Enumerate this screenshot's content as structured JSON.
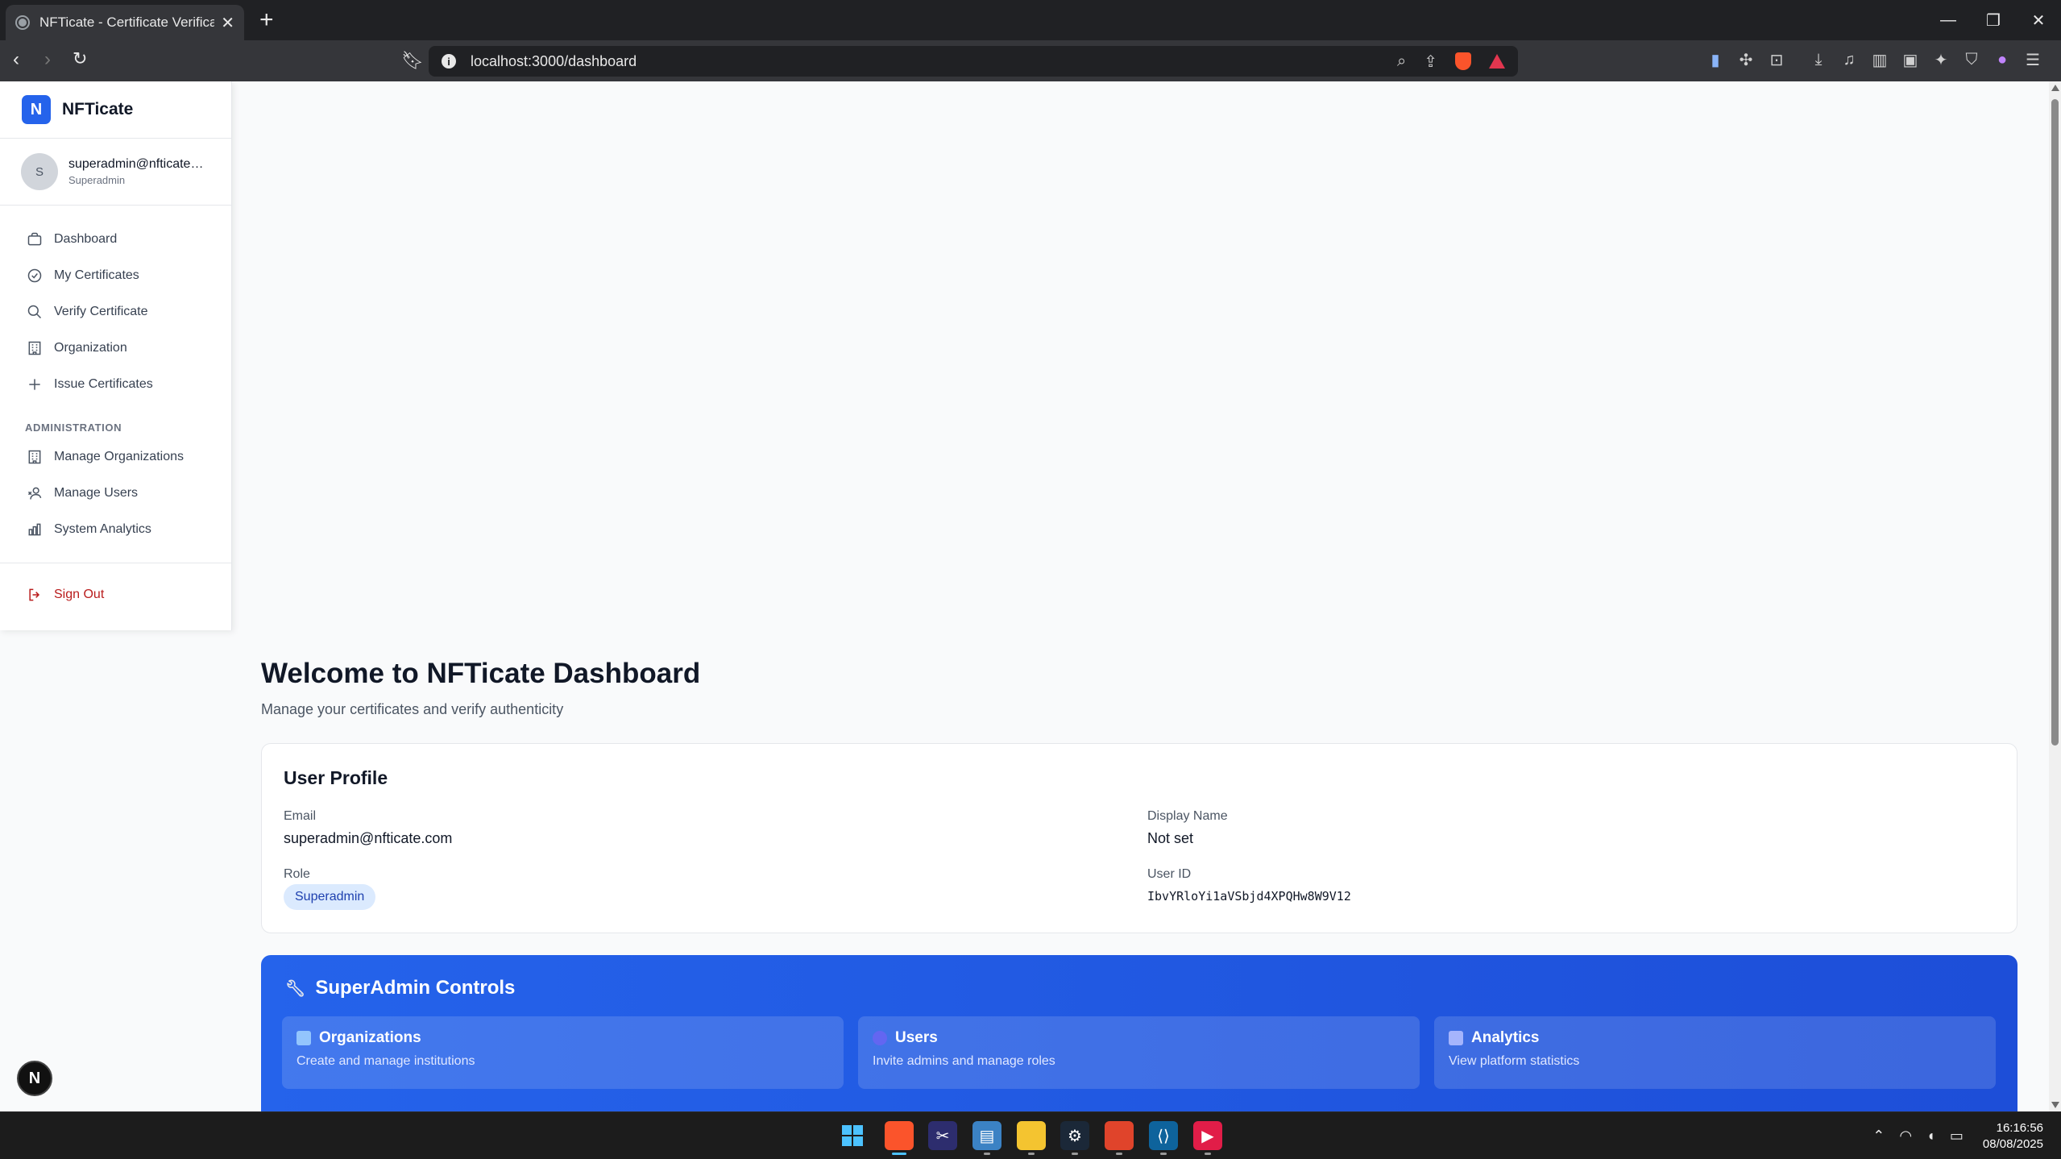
{
  "browser": {
    "tab_title": "NFTicate - Certificate Verification",
    "url": "localhost:3000/dashboard"
  },
  "sidebar": {
    "brand_letter": "N",
    "brand_name": "NFTicate",
    "user": {
      "avatar_letter": "S",
      "email": "superadmin@nfticate.com",
      "role": "Superadmin"
    },
    "items": [
      {
        "label": "Dashboard",
        "icon": "briefcase-icon"
      },
      {
        "label": "My Certificates",
        "icon": "check-circle-icon"
      },
      {
        "label": "Verify Certificate",
        "icon": "search-icon"
      },
      {
        "label": "Organization",
        "icon": "building-icon"
      },
      {
        "label": "Issue Certificates",
        "icon": "plus-icon"
      }
    ],
    "admin_section_label": "ADMINISTRATION",
    "admin_items": [
      {
        "label": "Manage Organizations",
        "icon": "building-icon"
      },
      {
        "label": "Manage Users",
        "icon": "users-icon"
      },
      {
        "label": "System Analytics",
        "icon": "bar-chart-icon"
      }
    ],
    "signout_label": "Sign Out"
  },
  "main": {
    "title": "Welcome to NFTicate Dashboard",
    "subtitle": "Manage your certificates and verify authenticity",
    "profile": {
      "title": "User Profile",
      "email_label": "Email",
      "email_value": "superadmin@nfticate.com",
      "display_name_label": "Display Name",
      "display_name_value": "Not set",
      "role_label": "Role",
      "role_value": "Superadmin",
      "user_id_label": "User ID",
      "user_id_value": "IbvYRloYi1aVSbjd4XPQHw8W9V12"
    },
    "superadmin": {
      "title": "SuperAdmin Controls",
      "cards": [
        {
          "title": "Organizations",
          "desc": "Create and manage institutions",
          "icon": "building-icon"
        },
        {
          "title": "Users",
          "desc": "Invite admins and manage roles",
          "icon": "users-icon"
        },
        {
          "title": "Analytics",
          "desc": "View platform statistics",
          "icon": "bar-chart-icon"
        }
      ]
    }
  },
  "dev_badge": "N",
  "taskbar": {
    "time": "16:16:56",
    "date": "08/08/2025"
  },
  "colors": {
    "brand_blue": "#2563eb",
    "signout_red": "#b91c1c",
    "role_badge_bg": "#dbeafe"
  }
}
